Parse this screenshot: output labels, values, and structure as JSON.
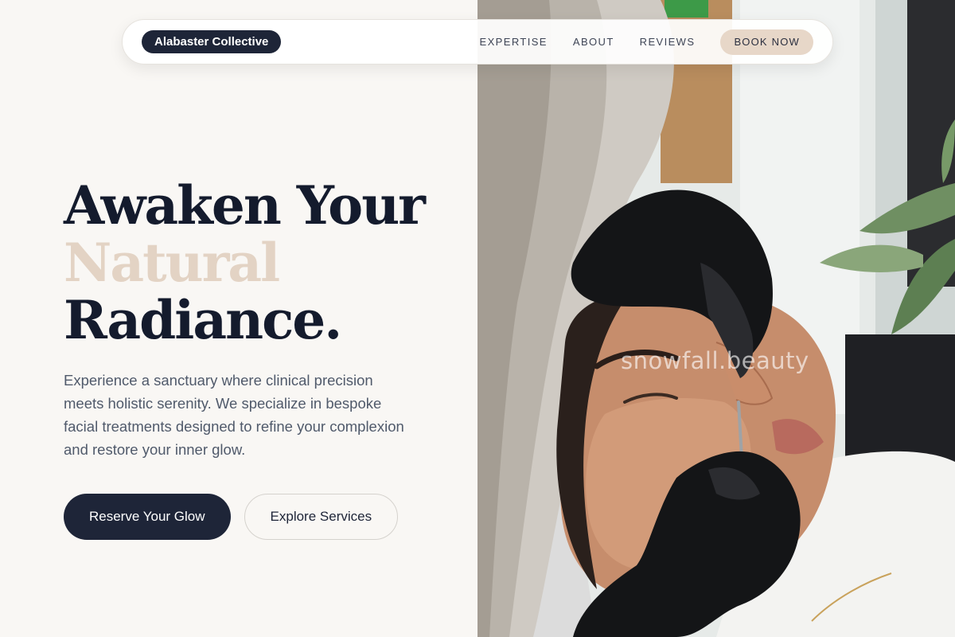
{
  "nav": {
    "brand": "Alabaster Collective",
    "links": [
      "EXPERTISE",
      "ABOUT",
      "REVIEWS"
    ],
    "cta": "BOOK NOW"
  },
  "hero": {
    "headline_line1": "Awaken Your",
    "headline_line2": "Natural",
    "headline_line3": "Radiance.",
    "description": "Experience a sanctuary where clinical precision meets holistic serenity. We specialize in bespoke facial treatments designed to refine your complexion and restore your inner glow.",
    "primary_cta": "Reserve Your Glow",
    "secondary_cta": "Explore Services"
  },
  "image": {
    "watermark": "snowfall.beauty"
  },
  "colors": {
    "navy": "#1e2538",
    "accent_beige": "#e3d3c4",
    "background": "#f9f7f4",
    "body_text": "#505a6b"
  }
}
